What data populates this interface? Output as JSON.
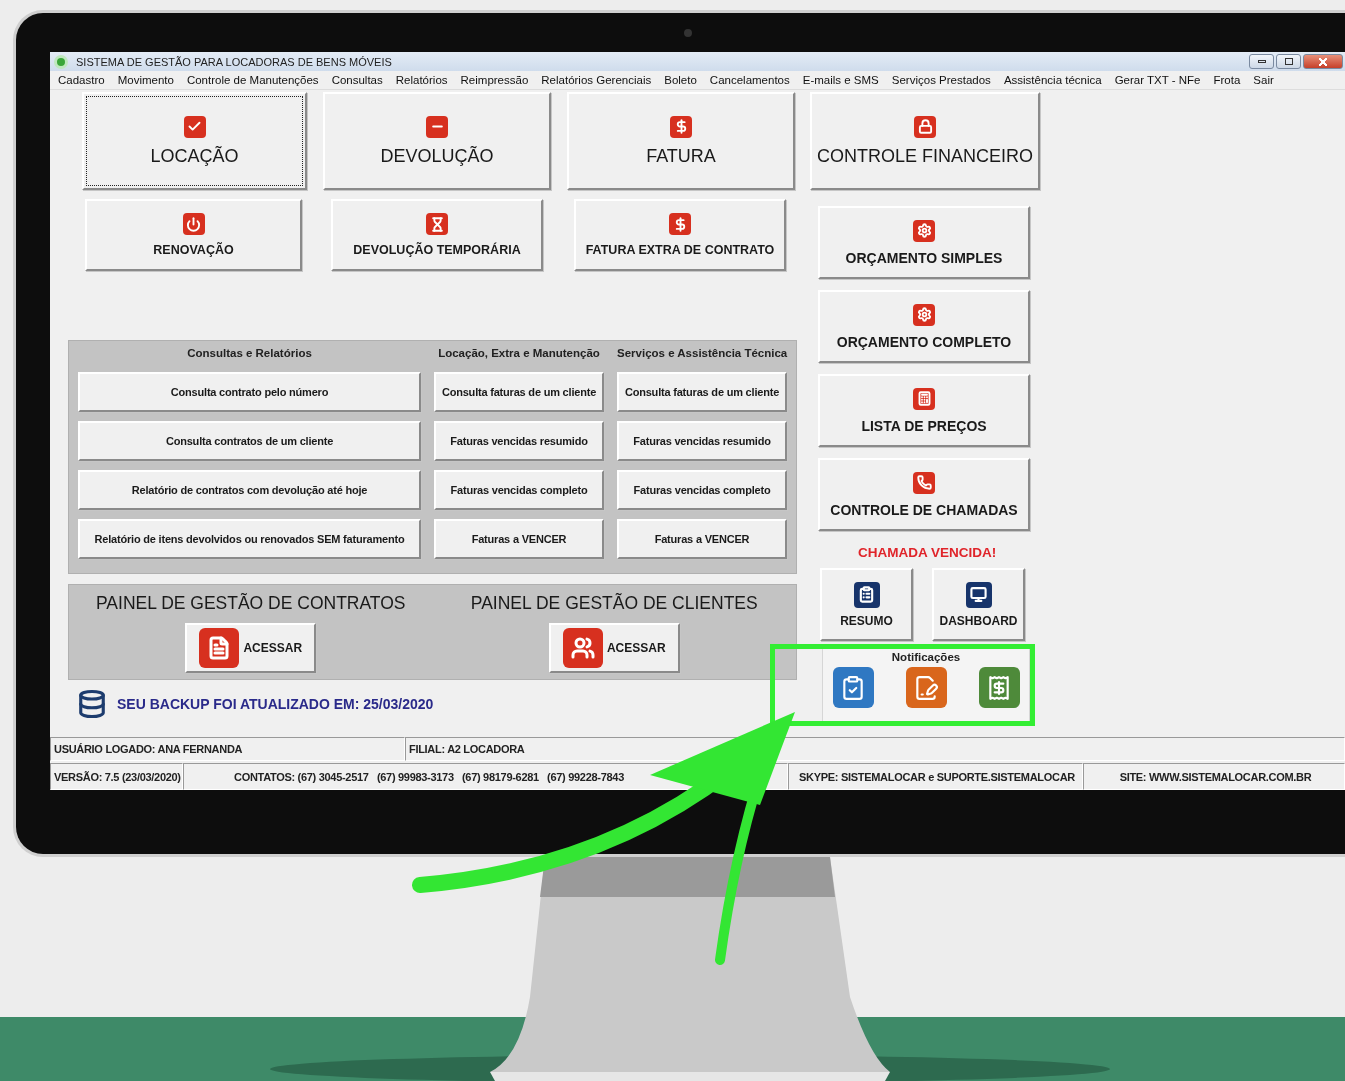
{
  "window": {
    "title": "SISTEMA DE GESTÃO PARA LOCADORAS DE BENS MÓVEIS"
  },
  "menu": [
    "Cadastro",
    "Movimento",
    "Controle de Manutenções",
    "Consultas",
    "Relatórios",
    "Reimpressão",
    "Relatórios Gerenciais",
    "Boleto",
    "Cancelamentos",
    "E-mails e SMS",
    "Serviços Prestados",
    "Assistência técnica",
    "Gerar TXT - NFe",
    "Frota",
    "Sair"
  ],
  "main_buttons": [
    {
      "label": "LOCAÇÃO",
      "focused": true
    },
    {
      "label": "DEVOLUÇÃO",
      "focused": false
    },
    {
      "label": "FATURA",
      "focused": false
    }
  ],
  "secondary_buttons": [
    "RENOVAÇÃO",
    "DEVOLUÇÃO TEMPORÁRIA",
    "FATURA EXTRA DE CONTRATO"
  ],
  "finance_button": "CONTROLE FINANCEIRO",
  "side_buttons": [
    "ORÇAMENTO SIMPLES",
    "ORÇAMENTO COMPLETO",
    "LISTA DE PREÇOS",
    "CONTROLE DE CHAMADAS"
  ],
  "alert": "CHAMADA VENCIDA!",
  "shortcut_buttons": [
    "RESUMO",
    "DASHBOARD"
  ],
  "notifications": {
    "title": "Notificações",
    "highlighted": true
  },
  "reports": [
    {
      "heading": "Consultas e Relatórios",
      "buttons": [
        "Consulta contrato pelo número",
        "Consulta contratos de um cliente",
        "Relatório de contratos com devolução até hoje",
        "Relatório de itens devolvidos ou renovados SEM faturamento"
      ]
    },
    {
      "heading": "Locação, Extra e Manutenção",
      "buttons": [
        "Consulta faturas de um cliente",
        "Faturas vencidas resumido",
        "Faturas vencidas completo",
        "Faturas a VENCER"
      ]
    },
    {
      "heading": "Serviços e Assistência Técnica",
      "buttons": [
        "Consulta faturas de um cliente",
        "Faturas vencidas resumido",
        "Faturas vencidas completo",
        "Faturas a VENCER"
      ]
    }
  ],
  "panels": [
    {
      "title": "PAINEL DE GESTÃO DE CONTRATOS",
      "button": "ACESSAR"
    },
    {
      "title": "PAINEL DE GESTÃO DE CLIENTES",
      "button": "ACESSAR"
    }
  ],
  "backup": "SEU BACKUP FOI ATUALIZADO EM: 25/03/2020",
  "status_bar": {
    "rows": [
      [
        "USUÁRIO LOGADO: ANA FERNANDA",
        "FILIAL: A2 LOCADORA"
      ],
      [
        "VERSÃO: 7.5 (23/03/2020)",
        "CONTATOS: (67) 3045-2517   (67) 99983-3173   (67) 98179-6281   (67) 99228-7843",
        "SKYPE: SISTEMALOCAR e SUPORTE.SISTEMALOCAR",
        "SITE: WWW.SISTEMALOCAR.COM.BR"
      ]
    ]
  }
}
